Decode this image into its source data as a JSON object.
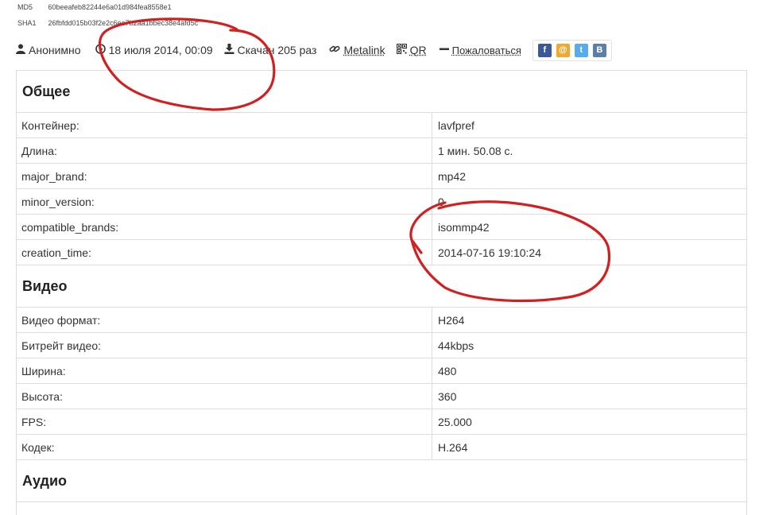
{
  "hashes": [
    {
      "key": "MD5",
      "value": "60beeafeb82244e6a01d984fea8558e1"
    },
    {
      "key": "SHA1",
      "value": "26fbfdd015b03f2e2c6ee7b2aa1bbec38e4afd5c"
    }
  ],
  "meta": {
    "author": "Анонимно",
    "date": "18 июля 2014, 00:09",
    "downloads": "Скачан 205 раз",
    "metalink": "Metalink",
    "qr": "QR",
    "report": "Пожаловаться"
  },
  "social": [
    {
      "icon": "facebook-icon",
      "label": "f",
      "color": "#3b5998"
    },
    {
      "icon": "mail-icon",
      "label": "@",
      "color": "#f0a830"
    },
    {
      "icon": "twitter-icon",
      "label": "t",
      "color": "#55acee"
    },
    {
      "icon": "vk-icon",
      "label": "В",
      "color": "#5b7fa6"
    }
  ],
  "sections": [
    {
      "title": "Общее",
      "rows": [
        {
          "key": "Контейнер:",
          "value": "lavfpref"
        },
        {
          "key": "Длина:",
          "value": "1 мин. 50.08 с."
        },
        {
          "key": "major_brand:",
          "value": "mp42"
        },
        {
          "key": "minor_version:",
          "value": "0"
        },
        {
          "key": "compatible_brands:",
          "value": "isommp42"
        },
        {
          "key": "creation_time:",
          "value": "2014-07-16 19:10:24"
        }
      ]
    },
    {
      "title": "Видео",
      "rows": [
        {
          "key": "Видео формат:",
          "value": "H264"
        },
        {
          "key": "Битрейт видео:",
          "value": "44kbps"
        },
        {
          "key": "Ширина:",
          "value": "480"
        },
        {
          "key": "Высота:",
          "value": "360"
        },
        {
          "key": "FPS:",
          "value": "25.000"
        },
        {
          "key": "Кодек:",
          "value": "H.264"
        }
      ]
    },
    {
      "title": "Аудио",
      "rows": []
    }
  ],
  "annotation_color": "#d21f1f"
}
